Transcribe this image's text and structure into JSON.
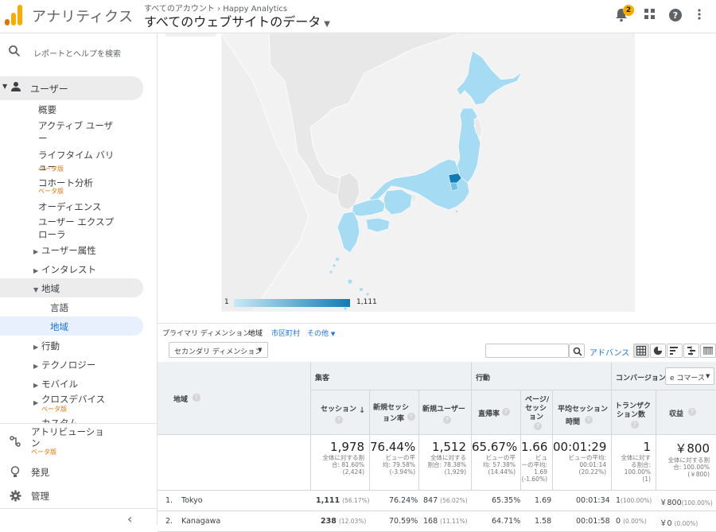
{
  "header": {
    "app_name": "アナリティクス",
    "breadcrumb_account": "すべてのアカウント",
    "breadcrumb_sep": "›",
    "breadcrumb_property": "Happy Analytics",
    "view_title": "すべてのウェブサイトのデータ",
    "notification_count": "2"
  },
  "sidebar": {
    "search_placeholder": "レポートとヘルプを検索",
    "users_section": "ユーザー",
    "items": {
      "overview": "概要",
      "active_users_1": "アクティブ ユーザ",
      "active_users_2": "ー",
      "lifetime_1": "ライフタイム バリ",
      "lifetime_2": "ュー",
      "lifetime_beta": "ベータ版",
      "cohort": "コホート分析",
      "cohort_beta": "ベータ版",
      "audiences": "オーディエンス",
      "explorer_1": "ユーザー エクスプ",
      "explorer_2": "ローラ",
      "attributes": "ユーザー属性",
      "interests": "インタレスト",
      "geo": "地域",
      "language": "言語",
      "location": "地域",
      "behavior": "行動",
      "technology": "テクノロジー",
      "mobile": "モバイル",
      "cross_device": "クロスデバイス",
      "cross_device_beta": "ベータ版",
      "custom_cut": "カスタム"
    },
    "attribution_1": "アトリビューショ",
    "attribution_2": "ン",
    "attribution_beta": "ベータ版",
    "discover": "発見",
    "admin": "管理",
    "collapse": "‹"
  },
  "map": {
    "legend_min": "1",
    "legend_max": "1,111",
    "colors": {
      "low": "#c8e9f7",
      "high": "#117bb5",
      "land": "#a6dcf3",
      "other": "#e6e6e6"
    }
  },
  "dimension_bar": {
    "label": "プライマリ ディメンション:",
    "active": "地域",
    "option_city": "市区町村",
    "option_other": "その他"
  },
  "toolbar": {
    "secondary_dimension": "セカンダリ ディメンション",
    "search_value": "",
    "advanced": "アドバンス"
  },
  "table": {
    "group_acq": "集客",
    "group_beh": "行動",
    "group_conv": "コンバージョン",
    "conv_select": "e コマース",
    "col_region": "地域",
    "col_sessions": "セッション",
    "col_new_rate_1": "新規セッシ",
    "col_new_rate_2": "ョン率",
    "col_new_users": "新規ユーザー",
    "col_bounce": "直帰率",
    "col_pps_1": "ページ/",
    "col_pps_2": "セッシ",
    "col_pps_3": "ョン",
    "col_avg_1": "平均セッション",
    "col_avg_2": "時間",
    "col_tx_1": "トランザク",
    "col_tx_2": "ション数",
    "col_rev": "収益",
    "totals": {
      "sessions": "1,978",
      "sessions_sub1": "全体に対する割",
      "sessions_sub2": "合: 81.60%",
      "sessions_sub3": "(2,424)",
      "new_rate": "76.44%",
      "new_rate_sub1": "ビューの平",
      "new_rate_sub2": "均: 79.58%",
      "new_rate_sub3": "(-3.94%)",
      "new_users": "1,512",
      "new_users_sub1": "全体に対する",
      "new_users_sub2": "割合: 78.38%",
      "new_users_sub3": "(1,929)",
      "bounce": "65.67%",
      "bounce_sub1": "ビューの平",
      "bounce_sub2": "均: 57.38%",
      "bounce_sub3": "(14.44%)",
      "pps": "1.66",
      "pps_sub1": "ビュ",
      "pps_sub2": "ーの平均:",
      "pps_sub3": "1.69",
      "pps_sub4": "(-1.60%)",
      "avg": "00:01:29",
      "avg_sub1": "ビューの平均:",
      "avg_sub2": "00:01:14",
      "avg_sub3": "(20.22%)",
      "tx": "1",
      "tx_sub1": "全体に対す",
      "tx_sub2": "る割合:",
      "tx_sub3": "100.00%",
      "tx_sub4": "(1)",
      "rev": "￥800",
      "rev_sub1": "全体に対する割",
      "rev_sub2": "合: 100.00%",
      "rev_sub3": "(￥800)"
    },
    "rows": [
      {
        "index": "1.",
        "region": "Tokyo",
        "sessions": "1,111",
        "sessions_pct": "(56.17%)",
        "new_rate": "76.24%",
        "new_users": "847",
        "new_users_pct": "(56.02%)",
        "bounce": "65.35%",
        "pps": "1.69",
        "avg": "00:01:34",
        "tx": "1",
        "tx_pct": "(100.00%)",
        "rev": "￥800",
        "rev_pct": "(100.00%)"
      },
      {
        "index": "2.",
        "region": "Kanagawa",
        "sessions": "238",
        "sessions_pct": "(12.03%)",
        "new_rate": "70.59%",
        "new_users": "168",
        "new_users_pct": "(11.11%)",
        "bounce": "64.71%",
        "pps": "1.58",
        "avg": "00:01:58",
        "tx": "0",
        "tx_pct": "(0.00%)",
        "rev": "￥0",
        "rev_pct": "(0.00%)"
      }
    ]
  }
}
